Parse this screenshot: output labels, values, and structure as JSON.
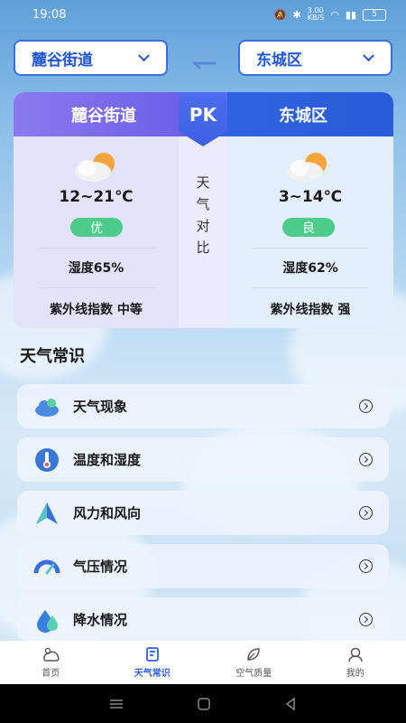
{
  "status": {
    "time": "19:08",
    "net": "3.00\nKB/S",
    "battery": "5"
  },
  "selectors": {
    "left_city": "麓谷街道",
    "right_city": "东城区"
  },
  "compare": {
    "left": {
      "name": "麓谷街道",
      "temp": "12~21℃",
      "aqi": "优",
      "humidity": "湿度65%",
      "uv": "紫外线指数 中等"
    },
    "center": {
      "pk": "PK",
      "vertical": [
        "天",
        "气",
        "对",
        "比"
      ]
    },
    "right": {
      "name": "东城区",
      "temp": "3~14℃",
      "aqi": "良",
      "humidity": "湿度62%",
      "uv": "紫外线指数 强"
    }
  },
  "section_title": "天气常识",
  "items": [
    {
      "label": "天气现象",
      "icon": "cloud-icon"
    },
    {
      "label": "温度和湿度",
      "icon": "thermometer-icon"
    },
    {
      "label": "风力和风向",
      "icon": "wind-icon"
    },
    {
      "label": "气压情况",
      "icon": "gauge-icon"
    },
    {
      "label": "降水情况",
      "icon": "raindrop-icon"
    }
  ],
  "nav": [
    {
      "label": "首页",
      "icon": "home-weather-icon"
    },
    {
      "label": "天气常识",
      "icon": "book-icon"
    },
    {
      "label": "空气质量",
      "icon": "leaf-icon"
    },
    {
      "label": "我的",
      "icon": "profile-icon"
    }
  ],
  "colors": {
    "accent": "#2f5fe0",
    "good": "#4ccb8a",
    "purple": "#6a5ee8"
  }
}
